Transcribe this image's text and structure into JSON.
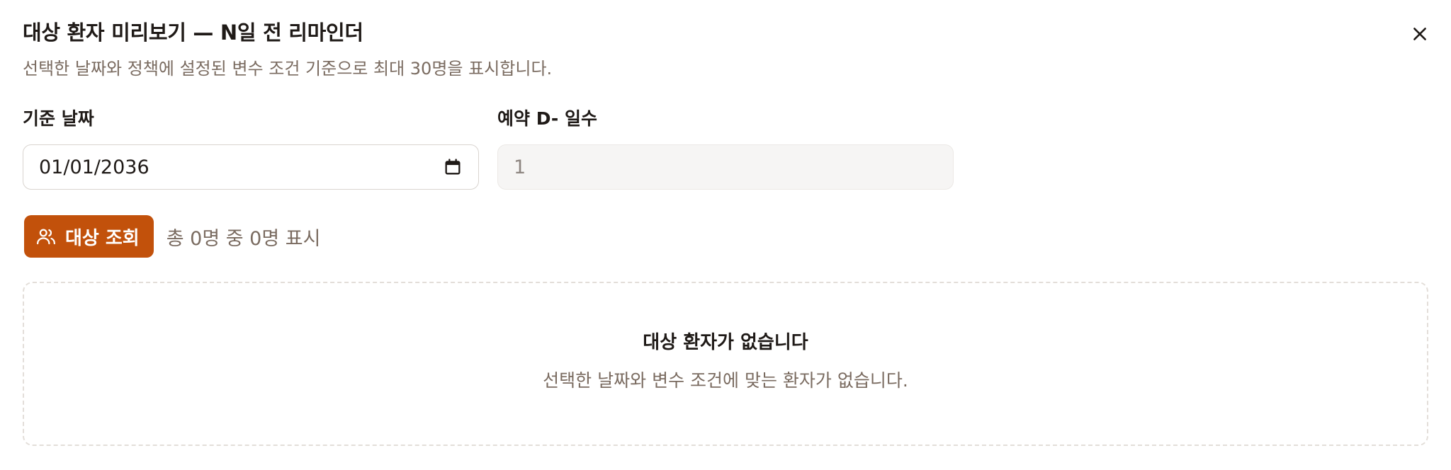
{
  "dialog": {
    "title": "대상 환자 미리보기 — N일 전 리마인더",
    "subtitle": "선택한 날짜와 정책에 설정된 변수 조건 기준으로 최대 30명을 표시합니다.",
    "close_icon": "close-icon"
  },
  "fields": {
    "date": {
      "label": "기준 날짜",
      "value": "01/01/2036",
      "icon": "calendar-icon"
    },
    "days": {
      "label": "예약 D- 일수",
      "value": "1"
    }
  },
  "actions": {
    "lookup_label": "대상 조회",
    "lookup_icon": "users-icon",
    "count_text": "총 0명 중 0명 표시"
  },
  "empty": {
    "title": "대상 환자가 없습니다",
    "description": "선택한 날짜와 변수 조건에 맞는 환자가 없습니다."
  },
  "colors": {
    "primary": "#c2510b",
    "muted_text": "#7a6b60",
    "border": "#d9d4cf"
  }
}
